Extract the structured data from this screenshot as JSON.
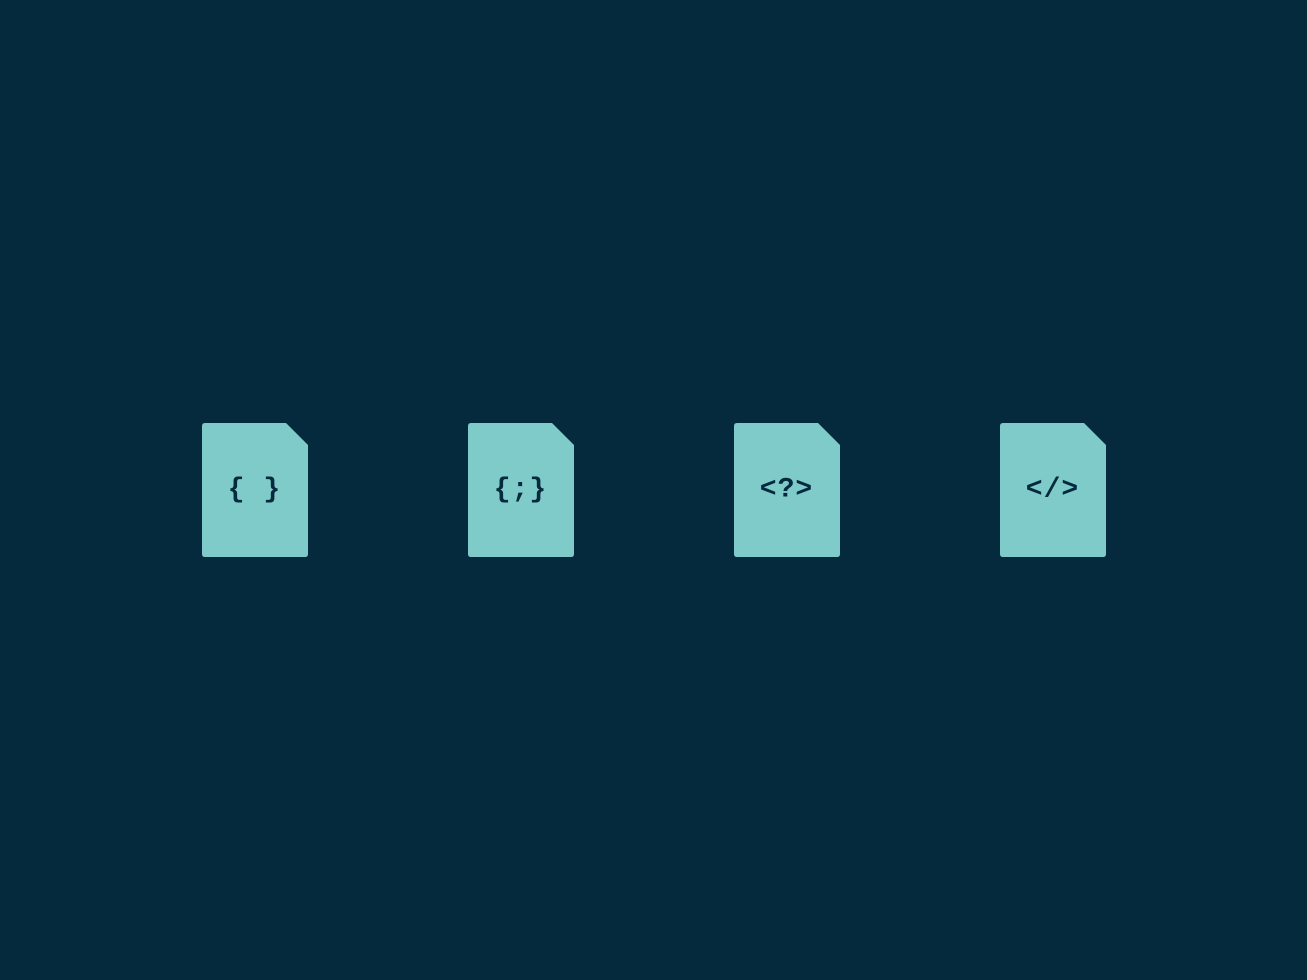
{
  "colors": {
    "background": "#052a3e",
    "file_fill": "#7fcbca",
    "symbol": "#052a3e"
  },
  "icons": [
    {
      "name": "json-file-icon",
      "symbol": "{ }"
    },
    {
      "name": "code-block-file-icon",
      "symbol": "{;}"
    },
    {
      "name": "php-file-icon",
      "symbol": "<?>"
    },
    {
      "name": "html-file-icon",
      "symbol": "</>"
    }
  ]
}
